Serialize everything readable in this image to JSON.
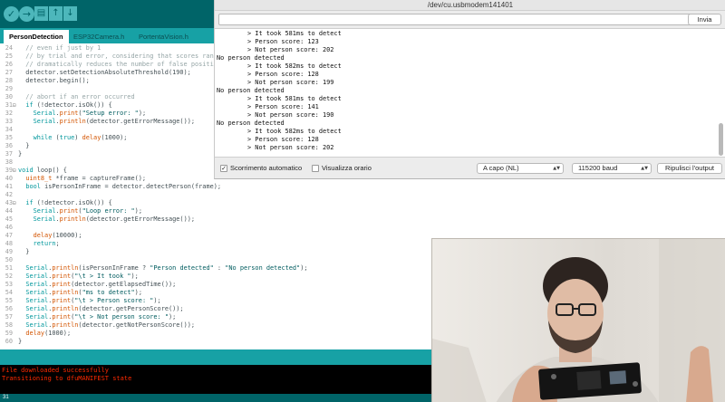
{
  "ide": {
    "toolbar": {
      "verify_icon": "check-icon",
      "upload_icon": "arrow-right-icon",
      "new_icon": "new-file-icon",
      "open_icon": "arrow-up-icon",
      "save_icon": "arrow-down-icon"
    },
    "tabs": [
      {
        "label": "PersonDetection",
        "active": true
      },
      {
        "label": "ESP32Camera.h",
        "active": false
      },
      {
        "label": "PortentaVision.h",
        "active": false
      }
    ],
    "code_lines": [
      {
        "num": "24",
        "fold": "",
        "text": "  // even if just by 1"
      },
      {
        "num": "25",
        "fold": "",
        "text": "  // by trial and error, considering that scores range"
      },
      {
        "num": "26",
        "fold": "",
        "text": "  // dramatically reduces the number of false positives"
      },
      {
        "num": "27",
        "fold": "",
        "text": "  detector.setDetectionAbsoluteThreshold(190);"
      },
      {
        "num": "28",
        "fold": "",
        "text": "  detector.begin();"
      },
      {
        "num": "29",
        "fold": "",
        "text": ""
      },
      {
        "num": "30",
        "fold": "",
        "text": "  // abort if an error occurred"
      },
      {
        "num": "31",
        "fold": "⊟",
        "text": "  if (!detector.isOk()) {"
      },
      {
        "num": "32",
        "fold": "",
        "text": "    Serial.print(\"Setup error: \");"
      },
      {
        "num": "33",
        "fold": "",
        "text": "    Serial.println(detector.getErrorMessage());"
      },
      {
        "num": "34",
        "fold": "",
        "text": ""
      },
      {
        "num": "35",
        "fold": "",
        "text": "    while (true) delay(1000);"
      },
      {
        "num": "36",
        "fold": "",
        "text": "  }"
      },
      {
        "num": "37",
        "fold": "",
        "text": "}"
      },
      {
        "num": "38",
        "fold": "",
        "text": ""
      },
      {
        "num": "39",
        "fold": "⊟",
        "text": "void loop() {"
      },
      {
        "num": "40",
        "fold": "",
        "text": "  uint8_t *frame = captureFrame();"
      },
      {
        "num": "41",
        "fold": "",
        "text": "  bool isPersonInFrame = detector.detectPerson(frame);"
      },
      {
        "num": "42",
        "fold": "",
        "text": ""
      },
      {
        "num": "43",
        "fold": "⊟",
        "text": "  if (!detector.isOk()) {"
      },
      {
        "num": "44",
        "fold": "",
        "text": "    Serial.print(\"Loop error: \");"
      },
      {
        "num": "45",
        "fold": "",
        "text": "    Serial.println(detector.getErrorMessage());"
      },
      {
        "num": "46",
        "fold": "",
        "text": ""
      },
      {
        "num": "47",
        "fold": "",
        "text": "    delay(10000);"
      },
      {
        "num": "48",
        "fold": "",
        "text": "    return;"
      },
      {
        "num": "49",
        "fold": "",
        "text": "  }"
      },
      {
        "num": "50",
        "fold": "",
        "text": ""
      },
      {
        "num": "51",
        "fold": "",
        "text": "  Serial.println(isPersonInFrame ? \"Person detected\" : \"No person detected\");"
      },
      {
        "num": "52",
        "fold": "",
        "text": "  Serial.print(\"\\t > It took \");"
      },
      {
        "num": "53",
        "fold": "",
        "text": "  Serial.print(detector.getElapsedTime());"
      },
      {
        "num": "54",
        "fold": "",
        "text": "  Serial.println(\"ms to detect\");"
      },
      {
        "num": "55",
        "fold": "",
        "text": "  Serial.print(\"\\t > Person score: \");"
      },
      {
        "num": "56",
        "fold": "",
        "text": "  Serial.println(detector.getPersonScore());"
      },
      {
        "num": "57",
        "fold": "",
        "text": "  Serial.print(\"\\t > Not person score: \");"
      },
      {
        "num": "58",
        "fold": "",
        "text": "  Serial.println(detector.getNotPersonScore());"
      },
      {
        "num": "59",
        "fold": "",
        "text": "  delay(1000);"
      },
      {
        "num": "60",
        "fold": "",
        "text": "}"
      }
    ],
    "console_lines": [
      "File downloaded successfully",
      "Transitioning to dfuMANIFEST state"
    ],
    "bottom_line_number": "31"
  },
  "serial_monitor": {
    "title": "/dev/cu.usbmodem141401",
    "send_label": "Invia",
    "input_value": "",
    "output_lines": [
      {
        "indent": true,
        "text": "> It took 581ms to detect"
      },
      {
        "indent": true,
        "text": "> Person score: 123"
      },
      {
        "indent": true,
        "text": "> Not person score: 202"
      },
      {
        "indent": false,
        "text": "No person detected"
      },
      {
        "indent": true,
        "text": "> It took 582ms to detect"
      },
      {
        "indent": true,
        "text": "> Person score: 128"
      },
      {
        "indent": true,
        "text": "> Not person score: 199"
      },
      {
        "indent": false,
        "text": "No person detected"
      },
      {
        "indent": true,
        "text": "> It took 581ms to detect"
      },
      {
        "indent": true,
        "text": "> Person score: 141"
      },
      {
        "indent": true,
        "text": "> Not person score: 190"
      },
      {
        "indent": false,
        "text": "No person detected"
      },
      {
        "indent": true,
        "text": "> It took 582ms to detect"
      },
      {
        "indent": true,
        "text": "> Person score: 128"
      },
      {
        "indent": true,
        "text": "> Not person score: 202"
      }
    ],
    "autoscroll_label": "Scorrimento automatico",
    "autoscroll_checked": true,
    "timestamp_label": "Visualizza orario",
    "timestamp_checked": false,
    "line_ending": "A capo (NL)",
    "baud_rate": "115200 baud",
    "clear_label": "Ripulisci l'output"
  },
  "colors": {
    "toolbar": "#006468",
    "tabbar": "#17a1a5",
    "console_text": "#ff2a00"
  }
}
